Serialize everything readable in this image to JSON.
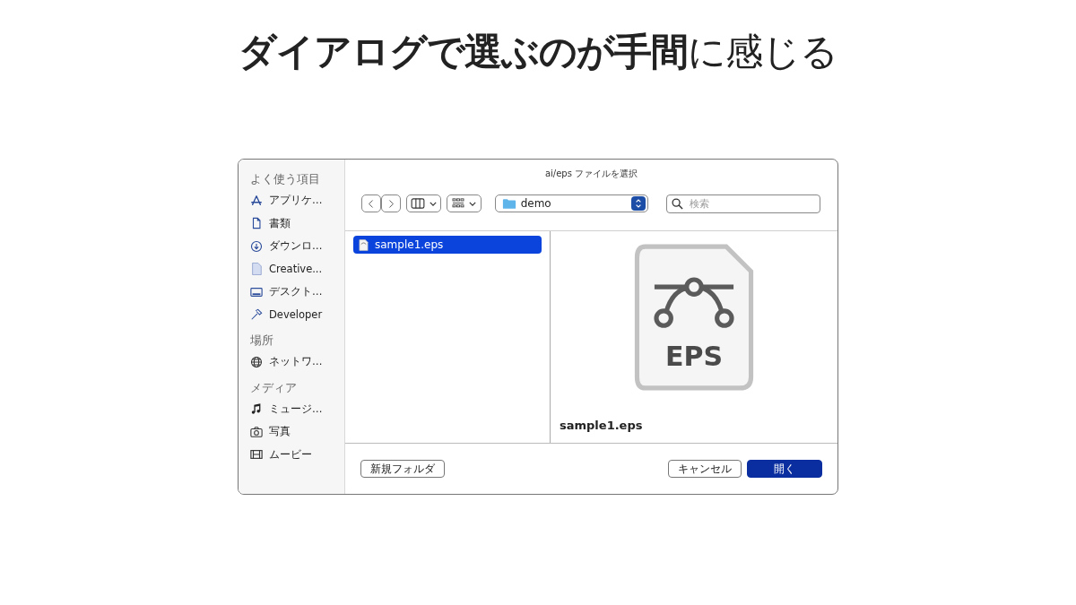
{
  "slide_title": "**ダイアログで選ぶのが手間**に感じる",
  "dialog": {
    "title": "ai/eps ファイルを選択",
    "sidebar": [
      {
        "heading": "よく使う項目",
        "items": [
          {
            "kind": "apps",
            "label": "アプリケ…"
          },
          {
            "kind": "doc",
            "label": "書類"
          },
          {
            "kind": "download",
            "label": "ダウンロ…"
          },
          {
            "kind": "file",
            "label": "Creative..."
          },
          {
            "kind": "desktop",
            "label": "デスクト…"
          },
          {
            "kind": "hammer",
            "label": "Developer"
          }
        ]
      },
      {
        "heading": "場所",
        "items": [
          {
            "kind": "network",
            "label": "ネットワ…"
          }
        ]
      },
      {
        "heading": "メディア",
        "items": [
          {
            "kind": "music",
            "label": "ミュージ…"
          },
          {
            "kind": "camera",
            "label": "写真"
          },
          {
            "kind": "film",
            "label": "ムービー"
          }
        ]
      }
    ],
    "location": "demo",
    "search": {
      "placeholder": "検索"
    },
    "files": [
      {
        "name": "sample1.eps",
        "selected": true
      }
    ],
    "preview": {
      "badge": "EPS",
      "name": "sample1.eps"
    },
    "buttons": {
      "new_folder": "新規フォルダ",
      "cancel": "キャンセル",
      "open": "開く"
    }
  }
}
